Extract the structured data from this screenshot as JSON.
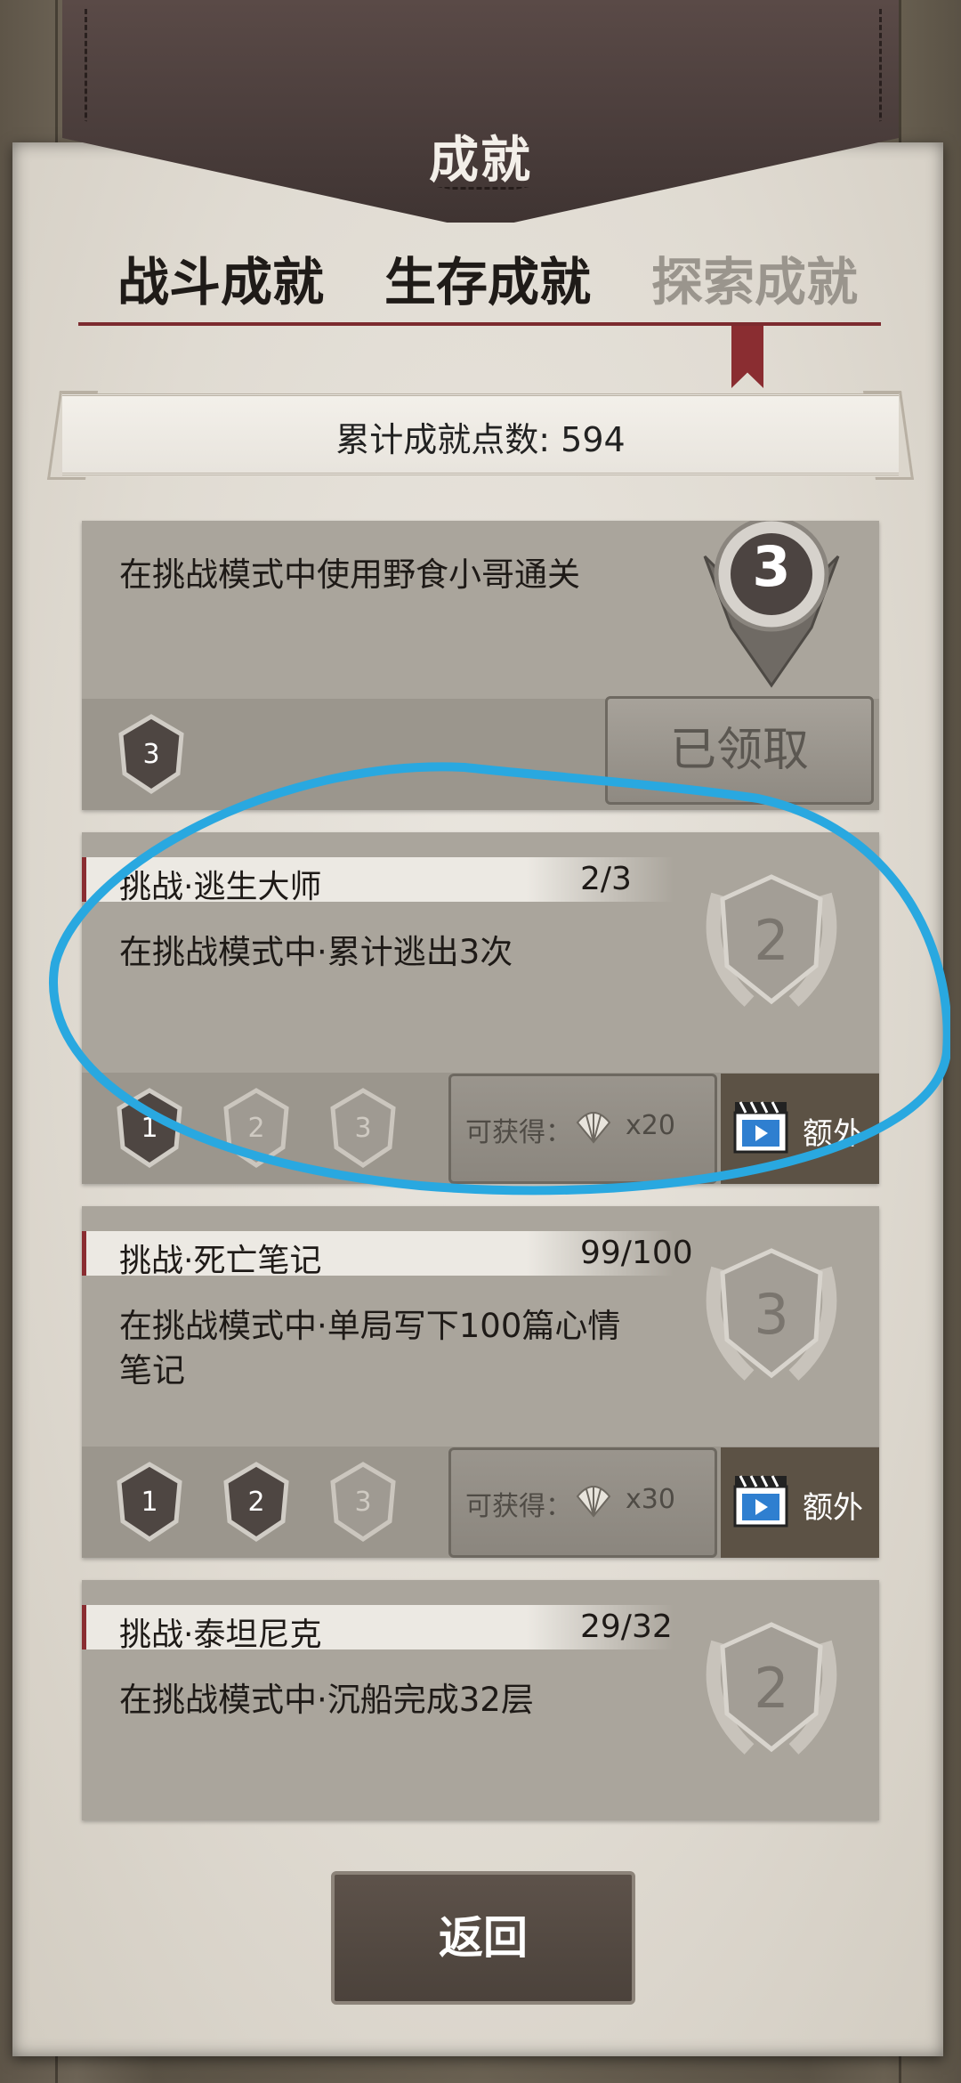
{
  "header": {
    "title": "成就"
  },
  "tabs": [
    {
      "label": "战斗成就",
      "active": true
    },
    {
      "label": "生存成就",
      "active": true
    },
    {
      "label": "探索成就",
      "active": false
    }
  ],
  "summary": {
    "text": "累计成就点数: 594"
  },
  "cards": [
    {
      "description": "在挑战模式中使用野食小哥通关",
      "medal_level": "3",
      "small_medal": "3",
      "claimed_label": "已领取"
    },
    {
      "name": "挑战·逃生大师",
      "progress": "2/3",
      "description": "在挑战模式中·累计逃出3次",
      "medal_level": "2",
      "small_medals": [
        "1",
        "2",
        "3"
      ],
      "small_medals_earned": [
        true,
        false,
        false
      ],
      "reward_label": "可获得：",
      "reward_qty": "x20",
      "extra_label": "额外"
    },
    {
      "name": "挑战·死亡笔记",
      "progress": "99/100",
      "description": "在挑战模式中·单局写下100篇心情笔记",
      "medal_level": "3",
      "small_medals": [
        "1",
        "2",
        "3"
      ],
      "small_medals_earned": [
        true,
        true,
        false
      ],
      "reward_label": "可获得：",
      "reward_qty": "x30",
      "extra_label": "额外"
    },
    {
      "name": "挑战·泰坦尼克",
      "progress": "29/32",
      "description": "在挑战模式中·沉船完成32层",
      "medal_level": "2"
    }
  ],
  "footer": {
    "return_label": "返回"
  },
  "colors": {
    "accent_red": "#8a2d31",
    "annotation_blue": "#29a8e0"
  }
}
